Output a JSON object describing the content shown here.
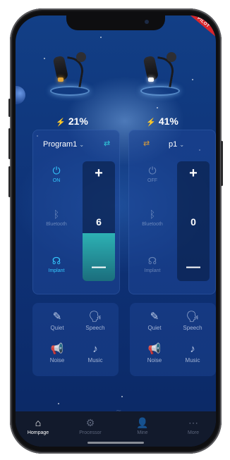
{
  "banner": {
    "label": "PILOT"
  },
  "devices": [
    {
      "side": "left",
      "led_color": "#e2a53a",
      "battery": "21%"
    },
    {
      "side": "right",
      "led_color": "#ffffff",
      "battery": "41%"
    }
  ],
  "programs": [
    {
      "name": "Program1",
      "sync_icon": "sync-arrows-icon",
      "power": {
        "icon": "power-icon",
        "label": "ON",
        "active": true
      },
      "bluetooth": {
        "icon": "bluetooth-icon",
        "label": "Bluetooth",
        "active": false
      },
      "implant": {
        "icon": "implant-icon",
        "label": "Implant",
        "active": true
      },
      "volume": {
        "plus": "+",
        "value": "6",
        "minus": "—",
        "level": 0.4
      }
    },
    {
      "name": "p1",
      "sync_icon": "sync-arrows-icon",
      "power": {
        "icon": "power-icon",
        "label": "OFF",
        "active": false
      },
      "bluetooth": {
        "icon": "bluetooth-icon",
        "label": "Bluetooth",
        "active": false
      },
      "implant": {
        "icon": "implant-icon",
        "label": "Implant",
        "active": false
      },
      "volume": {
        "plus": "+",
        "value": "0",
        "minus": "—",
        "level": 0.0
      }
    }
  ],
  "modes": [
    [
      {
        "label": "Quiet",
        "icon": "feather-icon"
      },
      {
        "label": "Speech",
        "icon": "speaking-head-icon"
      },
      {
        "label": "Noise",
        "icon": "megaphone-icon"
      },
      {
        "label": "Music",
        "icon": "music-note-icon"
      }
    ],
    [
      {
        "label": "Quiet",
        "icon": "feather-icon"
      },
      {
        "label": "Speech",
        "icon": "speaking-head-icon"
      },
      {
        "label": "Noise",
        "icon": "megaphone-icon"
      },
      {
        "label": "Music",
        "icon": "music-note-icon"
      }
    ]
  ],
  "tabs": [
    {
      "label": "Hompage",
      "icon": "home-icon",
      "selected": true
    },
    {
      "label": "Processor",
      "icon": "gear-icon",
      "selected": false
    },
    {
      "label": "Mine",
      "icon": "person-icon",
      "selected": false
    },
    {
      "label": "More",
      "icon": "more-icon",
      "selected": false
    }
  ],
  "colors": {
    "accent": "#35c9ff",
    "fill": "#2db2b4",
    "bg": "#0f3479"
  }
}
